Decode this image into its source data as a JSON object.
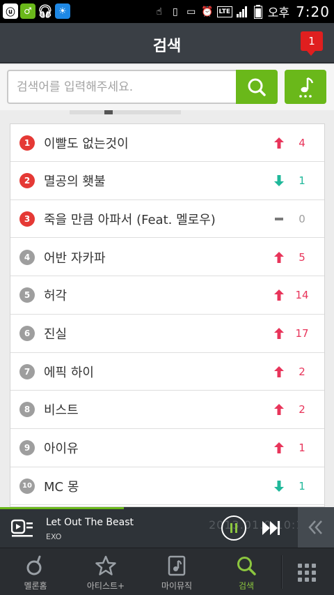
{
  "status_bar": {
    "lte": "LTE",
    "ampm": "오후",
    "time": "7:20"
  },
  "header": {
    "title": "검색",
    "notification_count": "1"
  },
  "search": {
    "placeholder": "검색어를 입력해주세요.",
    "value": ""
  },
  "ranking": [
    {
      "rank": "1",
      "title": "이빨도 없는것이",
      "trend": "up",
      "change": "4"
    },
    {
      "rank": "2",
      "title": "멸공의 횃불",
      "trend": "down",
      "change": "1"
    },
    {
      "rank": "3",
      "title": "죽을 만큼 아파서 (Feat. 멜로우)",
      "trend": "same",
      "change": "0"
    },
    {
      "rank": "4",
      "title": "어반 자카파",
      "trend": "up",
      "change": "5"
    },
    {
      "rank": "5",
      "title": "허각",
      "trend": "up",
      "change": "14"
    },
    {
      "rank": "6",
      "title": "진실",
      "trend": "up",
      "change": "17"
    },
    {
      "rank": "7",
      "title": "에픽 하이",
      "trend": "up",
      "change": "2"
    },
    {
      "rank": "8",
      "title": "비스트",
      "trend": "up",
      "change": "2"
    },
    {
      "rank": "9",
      "title": "아이유",
      "trend": "up",
      "change": "1"
    },
    {
      "rank": "10",
      "title": "MC 몽",
      "trend": "down",
      "change": "1"
    }
  ],
  "now_playing": {
    "title": "Let Out The Beast",
    "artist": "EXO",
    "background_text": "2013.01.0  10:10 현"
  },
  "bottom_nav": [
    {
      "label": "멜론홈",
      "icon": "melon-home-icon",
      "active": false
    },
    {
      "label": "아티스트+",
      "icon": "star-icon",
      "active": false
    },
    {
      "label": "마이뮤직",
      "icon": "my-music-icon",
      "active": false
    },
    {
      "label": "검색",
      "icon": "search-icon",
      "active": true
    }
  ],
  "colors": {
    "accent_green": "#6ab81a",
    "up_red": "#e8345a",
    "down_green": "#1fb89a",
    "same_gray": "#9e9e9e",
    "rank_top": "#e53935"
  }
}
